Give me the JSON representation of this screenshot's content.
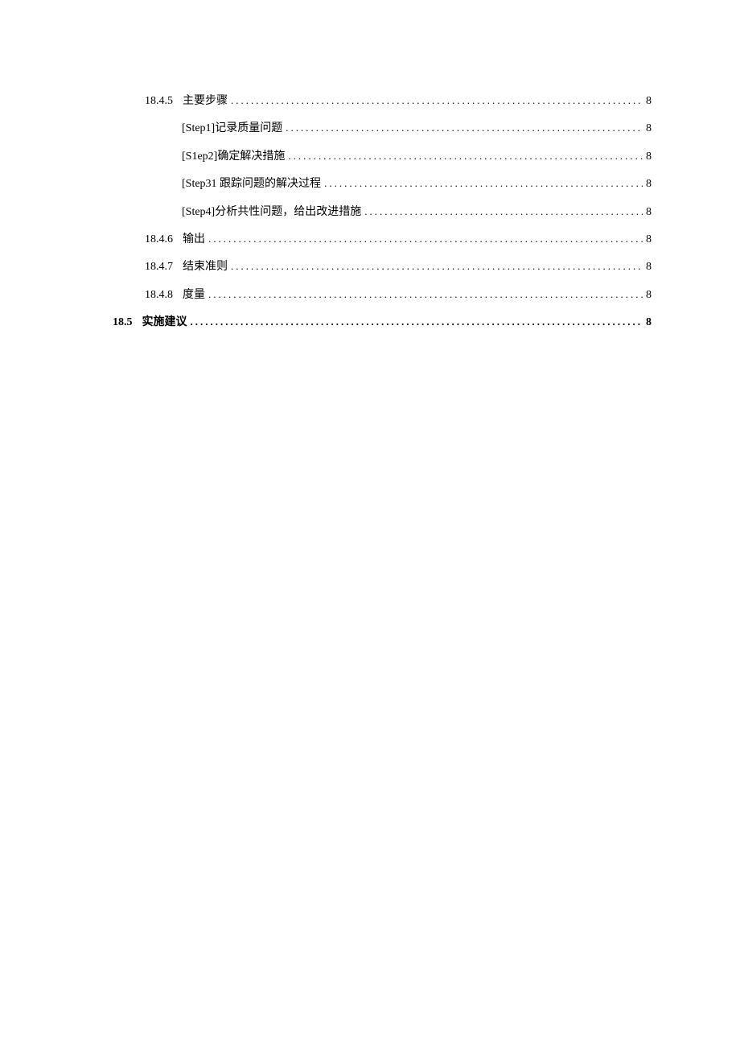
{
  "toc": {
    "entries": [
      {
        "number": "18.4.5",
        "title": "主要步骤",
        "page": "8",
        "level": 2,
        "bold": false
      },
      {
        "number": "",
        "title": "[Step1]记录质量问题",
        "page": "8",
        "level": 3,
        "bold": false
      },
      {
        "number": "",
        "title": "[S1ep2]确定解决措施",
        "page": "8",
        "level": 3,
        "bold": false
      },
      {
        "number": "",
        "title": "[Step31 跟踪问题的解决过程",
        "page": "8",
        "level": 3,
        "bold": false
      },
      {
        "number": "",
        "title": "[Step4]分析共性问题，给出改进措施",
        "page": "8",
        "level": 3,
        "bold": false
      },
      {
        "number": "18.4.6",
        "title": "输出",
        "page": "8",
        "level": 2,
        "bold": false
      },
      {
        "number": "18.4.7",
        "title": "结束准则",
        "page": "8",
        "level": 2,
        "bold": false
      },
      {
        "number": "18.4.8",
        "title": "度量",
        "page": "8",
        "level": 2,
        "bold": false
      },
      {
        "number": "18.5",
        "title": "实施建议",
        "page": "8",
        "level": 1,
        "bold": true
      }
    ]
  }
}
